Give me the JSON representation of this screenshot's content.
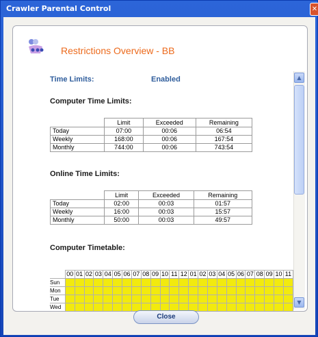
{
  "window": {
    "title": "Crawler Parental Control"
  },
  "header": {
    "title": "Restrictions Overview - BB"
  },
  "time_limits": {
    "label": "Time Limits:",
    "value": "Enabled"
  },
  "computer_limits": {
    "title": "Computer Time Limits:",
    "columns": [
      "Limit",
      "Exceeded",
      "Remaining"
    ],
    "rows": [
      {
        "label": "Today",
        "limit": "07:00",
        "exceeded": "00:06",
        "remaining": "06:54"
      },
      {
        "label": "Weekly",
        "limit": "168:00",
        "exceeded": "00:06",
        "remaining": "167:54"
      },
      {
        "label": "Monthly",
        "limit": "744:00",
        "exceeded": "00:06",
        "remaining": "743:54"
      }
    ]
  },
  "online_limits": {
    "title": "Online Time Limits:",
    "columns": [
      "Limit",
      "Exceeded",
      "Remaining"
    ],
    "rows": [
      {
        "label": "Today",
        "limit": "02:00",
        "exceeded": "00:03",
        "remaining": "01:57"
      },
      {
        "label": "Weekly",
        "limit": "16:00",
        "exceeded": "00:03",
        "remaining": "15:57"
      },
      {
        "label": "Monthly",
        "limit": "50:00",
        "exceeded": "00:03",
        "remaining": "49:57"
      }
    ]
  },
  "timetable": {
    "title": "Computer Timetable:",
    "hours": [
      "00",
      "01",
      "02",
      "03",
      "04",
      "05",
      "06",
      "07",
      "08",
      "09",
      "10",
      "11",
      "12",
      "01",
      "02",
      "03",
      "04",
      "05",
      "06",
      "07",
      "08",
      "09",
      "10",
      "11"
    ],
    "days": [
      "Sun",
      "Mon",
      "Tue",
      "Wed"
    ],
    "color_allowed": "#f2ea0e"
  },
  "buttons": {
    "close": "Close"
  }
}
